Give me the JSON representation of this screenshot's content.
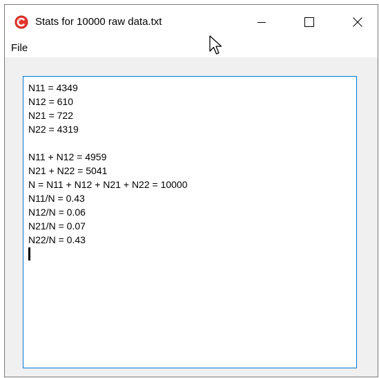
{
  "window": {
    "title": "Stats for 10000 raw data.txt",
    "app_icon": "app-icon-red-circle"
  },
  "controls": {
    "minimize_icon": "minimize-icon",
    "maximize_icon": "maximize-icon",
    "close_icon": "close-icon"
  },
  "menu": {
    "items": [
      {
        "label": "File"
      }
    ]
  },
  "editor": {
    "lines": [
      "N11 = 4349",
      "N12 = 610",
      "N21 = 722",
      "N22 = 4319",
      "",
      "N11 + N12 = 4959",
      "N21 + N22 = 5041",
      "N = N11 + N12 + N21 + N22 = 10000",
      "N11/N = 0.43",
      "N12/N = 0.06",
      "N21/N = 0.07",
      "N22/N = 0.43"
    ]
  },
  "colors": {
    "focus_border": "#0078d7",
    "client_background": "#f0f0f0",
    "app_icon_red": "#e8352c"
  }
}
